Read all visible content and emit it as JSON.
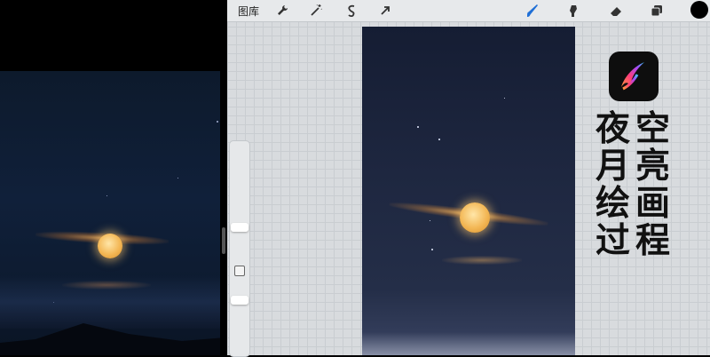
{
  "toolbar": {
    "gallery_label": "图库",
    "tools_left": [
      "wrench-icon",
      "magic-wand-icon",
      "selection-icon",
      "transform-arrow-icon"
    ],
    "tools_right": [
      "brush-icon",
      "smudge-icon",
      "eraser-icon",
      "layers-icon"
    ],
    "current_color": "#000000"
  },
  "title": {
    "lines": [
      "夜空",
      "月亮",
      "绘画",
      "过程"
    ]
  },
  "colors": {
    "sky_top": "#151d33",
    "sky_bottom": "#3a4463",
    "moon": "#f3b755",
    "brush_active": "#1f6fd6"
  }
}
